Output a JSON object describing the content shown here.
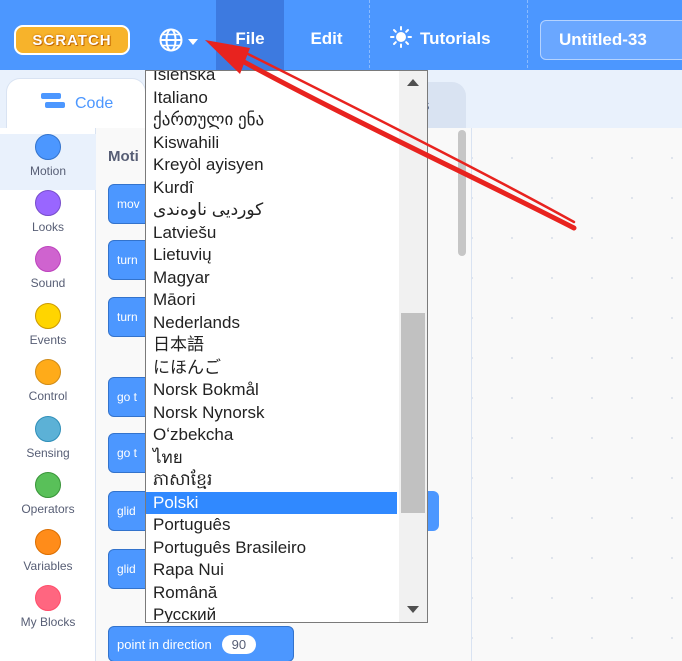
{
  "menubar": {
    "logo_text": "SCRATCH",
    "file_label": "File",
    "edit_label": "Edit",
    "tutorials_label": "Tutorials",
    "project_title": "Untitled-33",
    "language_icon": "globe-icon",
    "tutorials_icon": "lightbulb-icon"
  },
  "tabs": {
    "code_label": "Code",
    "sounds_label_visible": "s"
  },
  "categories": [
    {
      "label": "Motion",
      "color": "#4c97ff"
    },
    {
      "label": "Looks",
      "color": "#9966ff"
    },
    {
      "label": "Sound",
      "color": "#cf63cf"
    },
    {
      "label": "Events",
      "color": "#ffd500"
    },
    {
      "label": "Control",
      "color": "#ffab19"
    },
    {
      "label": "Sensing",
      "color": "#5cb1d6"
    },
    {
      "label": "Operators",
      "color": "#59c059"
    },
    {
      "label": "Variables",
      "color": "#ff8c1a"
    },
    {
      "label": "My Blocks",
      "color": "#ff6680"
    }
  ],
  "palette": {
    "section_title": "Moti",
    "blocks": [
      "mov",
      "turn",
      "turn",
      "go t",
      "go t",
      "glid",
      "glid"
    ],
    "point_in_direction": {
      "label": "point in direction",
      "value": "90"
    }
  },
  "language_menu": {
    "items": [
      "Íslenska",
      "Italiano",
      "ქართული ენა",
      "Kiswahili",
      "Kreyòl ayisyen",
      "Kurdî",
      "کوردیی ناوەندی",
      "Latviešu",
      "Lietuvių",
      "Magyar",
      "Māori",
      "Nederlands",
      "日本語",
      "にほんご",
      "Norsk Bokmål",
      "Norsk Nynorsk",
      "Oʻzbekcha",
      "ไทย",
      "ភាសាខ្មែរ",
      "Polski",
      "Português",
      "Português Brasileiro",
      "Rapa Nui",
      "Română",
      "Русский"
    ],
    "selected": "Polski"
  },
  "colors": {
    "menubar": "#4c97ff",
    "selected_item": "#3089ff",
    "annotation_arrow": "#e8231f"
  }
}
